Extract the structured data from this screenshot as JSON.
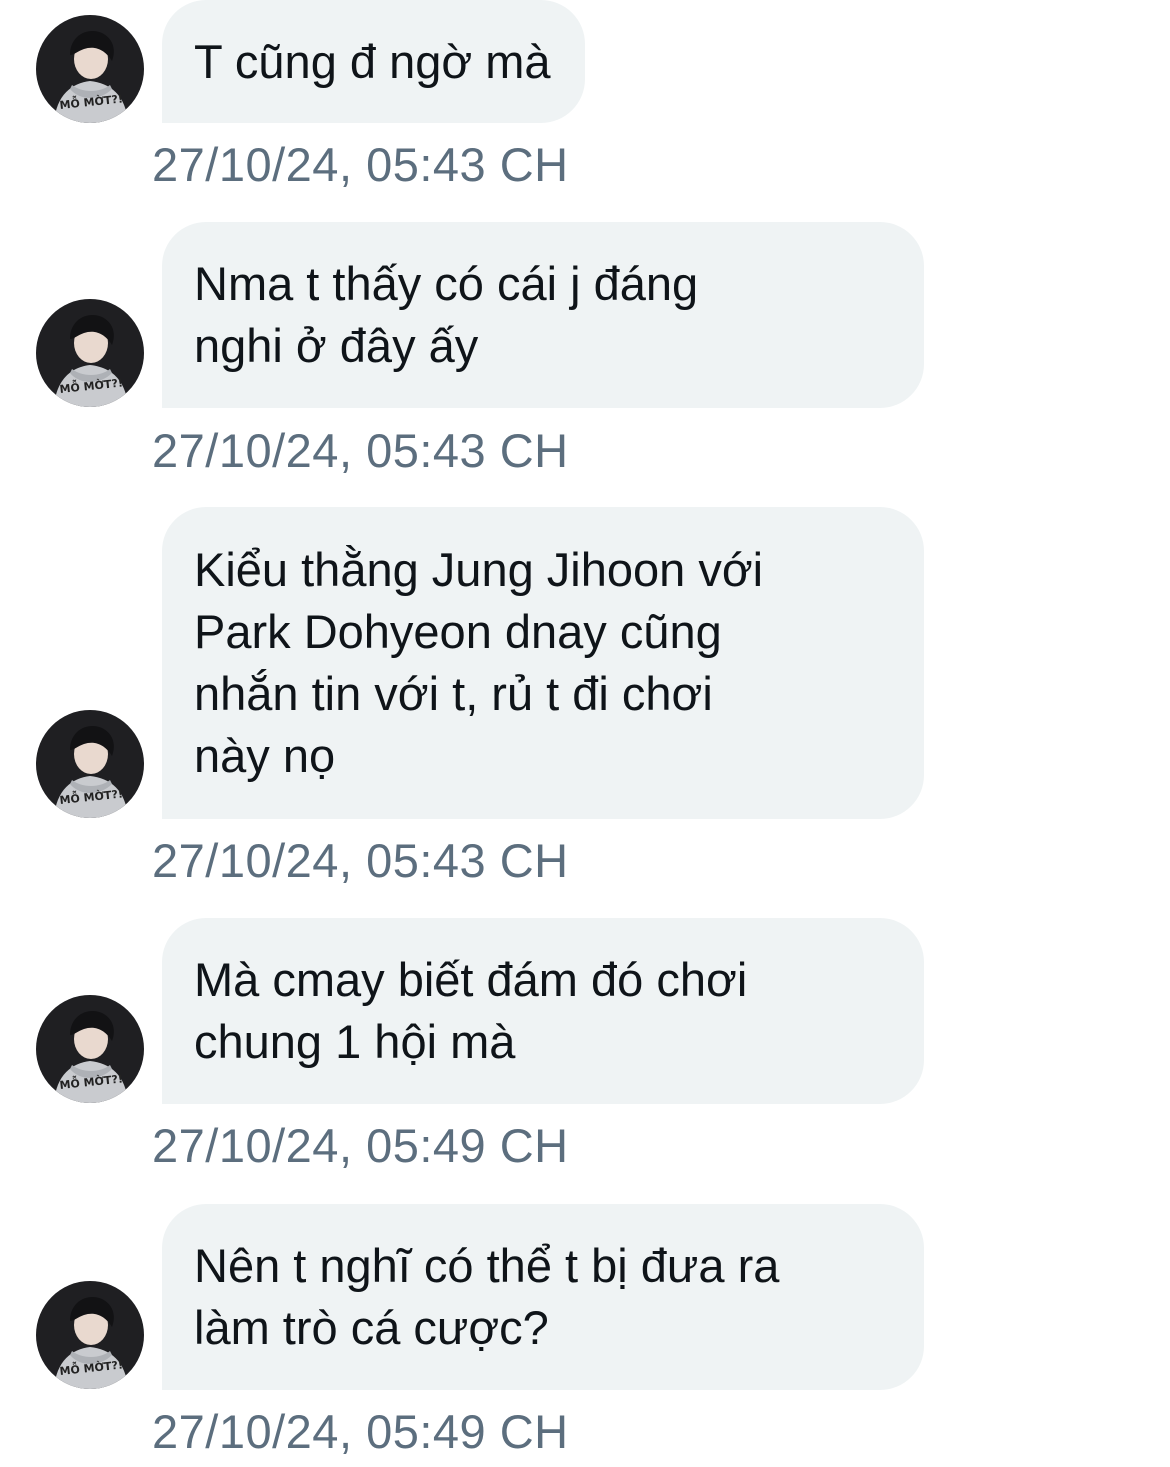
{
  "messages": [
    {
      "text": "T cũng đ ngờ mà",
      "time": "27/10/24, 05:43 CH"
    },
    {
      "text": "Nma t thấy có cái j đáng\nnghi ở đây ấy",
      "time": "27/10/24, 05:43 CH"
    },
    {
      "text": "Kiểu thằng Jung Jihoon với\nPark Dohyeon dnay cũng\nnhắn tin với t, rủ t đi chơi\nnày nọ",
      "time": "27/10/24, 05:43 CH"
    },
    {
      "text": "Mà cmay biết đám đó chơi\nchung 1 hội mà",
      "time": "27/10/24, 05:49 CH"
    },
    {
      "text": "Nên t nghĩ có thể t bị đưa ra\nlàm trò cá cược?",
      "time": "27/10/24, 05:49 CH"
    }
  ],
  "avatar": {
    "icon": "user-avatar-photo",
    "hoodie_print": "MỖ MỜT?!"
  },
  "colors": {
    "bubble": "#eff3f4",
    "text": "#0f1419",
    "timestamp": "#5c6e7e",
    "background": "#ffffff"
  }
}
